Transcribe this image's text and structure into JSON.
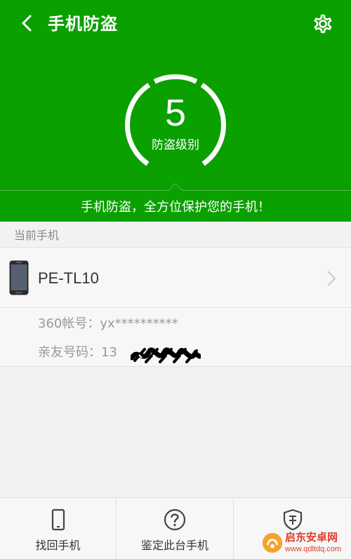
{
  "header": {
    "title": "手机防盗",
    "back_icon": "chevron-left-icon",
    "settings_icon": "gear-icon",
    "background_color": "#0aa000"
  },
  "gauge": {
    "level": "5",
    "label": "防盗级别"
  },
  "slogan": "手机防盗，全方位保护您的手机！",
  "current_device": {
    "section_label": "当前手机",
    "device_name": "PE-TL10",
    "account_label": "360帐号：",
    "account_value": "yx**********",
    "contact_label": "亲友号码：",
    "contact_value": "13"
  },
  "bottom_tabs": [
    {
      "label": "找回手机",
      "icon": "phone-icon"
    },
    {
      "label": "鉴定此台手机",
      "icon": "help-circle-icon"
    },
    {
      "label": "",
      "icon": "shield-icon"
    }
  ],
  "watermark": {
    "text": "启东安卓网",
    "url": "www.qdltdq.com"
  }
}
